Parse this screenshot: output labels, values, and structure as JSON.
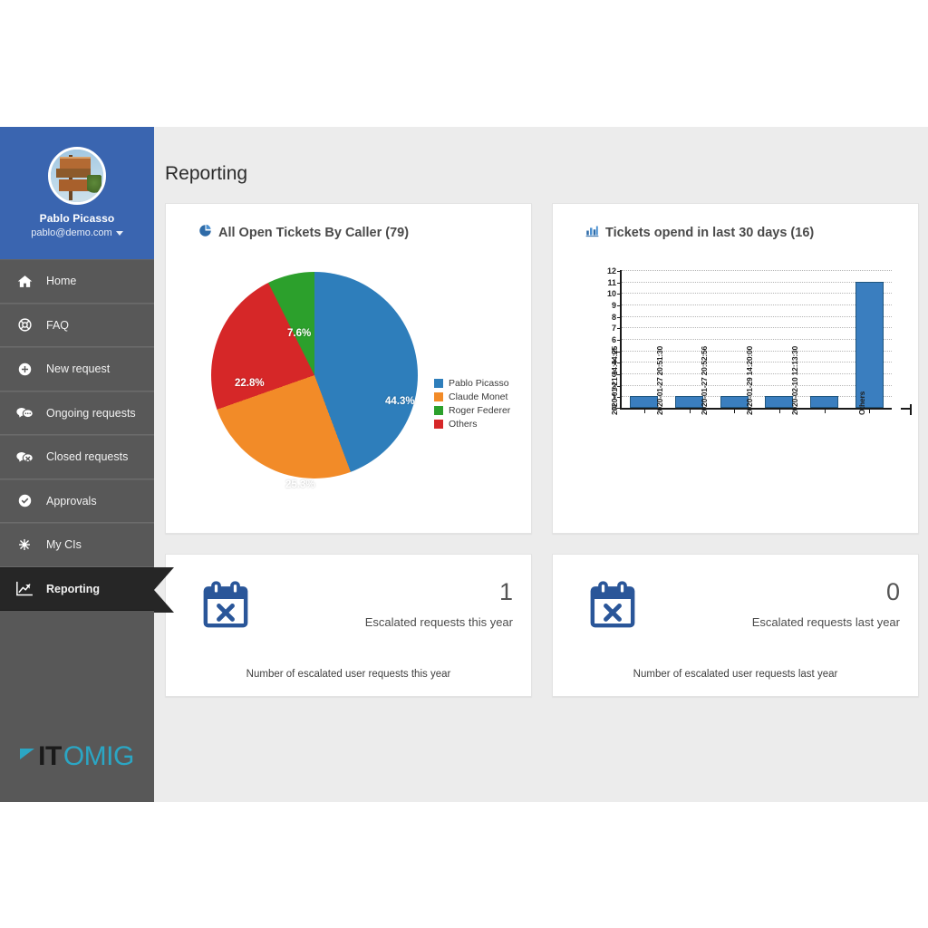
{
  "sidebar": {
    "user": {
      "name": "Pablo Picasso",
      "email": "pablo@demo.com",
      "avatar_icon": "user-avatar-photo",
      "caret_icon": "chevron-down-icon"
    },
    "items": [
      {
        "label": "Home",
        "icon": "home-icon",
        "active": false
      },
      {
        "label": "FAQ",
        "icon": "lifering-icon",
        "active": false
      },
      {
        "label": "New request",
        "icon": "plus-circle-icon",
        "active": false
      },
      {
        "label": "Ongoing requests",
        "icon": "comments-icon",
        "active": false
      },
      {
        "label": "Closed requests",
        "icon": "comment-close-icon",
        "active": false
      },
      {
        "label": "Approvals",
        "icon": "check-circle-icon",
        "active": false
      },
      {
        "label": "My CIs",
        "icon": "sitemap-icon",
        "active": false
      },
      {
        "label": "Reporting",
        "icon": "line-chart-icon",
        "active": true
      }
    ],
    "logo": {
      "part1": "IT",
      "part2": "OMIG",
      "mark_icon": "itomig-triangle-icon"
    }
  },
  "header": {
    "title": "Reporting"
  },
  "cards": {
    "pie": {
      "title": "All Open Tickets By Caller (79)",
      "icon": "pie-chart-icon"
    },
    "bar": {
      "title": "Tickets opend in last 30 days (16)",
      "icon": "bar-chart-icon"
    },
    "kpi_left": {
      "value": "1",
      "label": "Escalated requests this year",
      "footer": "Number of escalated user requests this year",
      "icon": "calendar-times-icon",
      "icon_color": "#2a5699"
    },
    "kpi_right": {
      "value": "0",
      "label": "Escalated requests last year",
      "footer": "Number of escalated user requests last year",
      "icon": "calendar-times-icon",
      "icon_color": "#2a5699"
    }
  },
  "chart_data": [
    {
      "type": "pie",
      "title": "All Open Tickets By Caller (79)",
      "total": 79,
      "categories": [
        "Pablo Picasso",
        "Claude Monet",
        "Roger Federer",
        "Others"
      ],
      "values": [
        44.3,
        25.3,
        7.6,
        22.8
      ],
      "value_unit": "percent",
      "data_labels": [
        "44.3%",
        "25.3%",
        "7.6%",
        "22.8%"
      ],
      "colors": [
        "#2e7ebb",
        "#f28b28",
        "#2ca02c",
        "#d62728"
      ],
      "slice_order": [
        "Pablo Picasso",
        "Claude Monet",
        "Others",
        "Roger Federer"
      ],
      "legend": {
        "position": "right",
        "entries": [
          {
            "label": "Pablo Picasso",
            "color": "#2e7ebb"
          },
          {
            "label": "Claude Monet",
            "color": "#f28b28"
          },
          {
            "label": "Roger Federer",
            "color": "#2ca02c"
          },
          {
            "label": "Others",
            "color": "#d62728"
          }
        ]
      }
    },
    {
      "type": "bar",
      "title": "Tickets opend in last 30 days (16)",
      "categories": [
        "2020-01-21 14:44:25",
        "2020-01-27 20:51:30",
        "2020-01-27 20:52:56",
        "2020-01-29 14:20:00",
        "2020-02-10 12:13:30",
        "Others"
      ],
      "values": [
        1,
        1,
        1,
        1,
        1,
        11
      ],
      "ylim": [
        0,
        12
      ],
      "yticks": [
        0,
        1,
        2,
        3,
        4,
        5,
        6,
        7,
        8,
        9,
        10,
        11,
        12
      ],
      "xlabel": "",
      "ylabel": "",
      "grid": true,
      "bar_color": "#3a7ebf",
      "bar_border_color": "#20567f",
      "legend": {
        "position": "none",
        "entries": []
      }
    }
  ],
  "colors": {
    "sidebar_user_bg": "#3a65b0",
    "sidebar_bg": "#585858",
    "sidebar_active_bg": "#262626",
    "content_bg": "#ececec",
    "logo_accent": "#2ba6c4"
  }
}
